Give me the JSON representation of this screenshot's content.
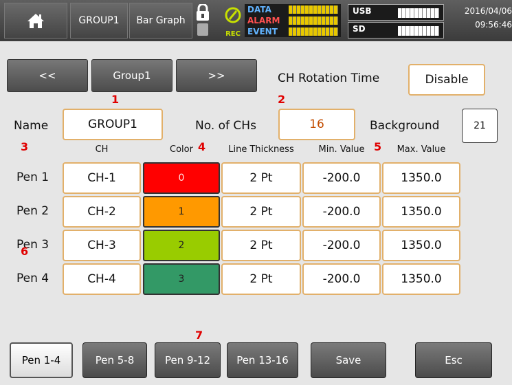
{
  "topbar": {
    "group": "GROUP1",
    "view": "Bar Graph",
    "rec": "REC",
    "status": [
      {
        "label": "DATA",
        "color": "#62b4ff"
      },
      {
        "label": "ALARM",
        "color": "#ff5050"
      },
      {
        "label": "EVENT",
        "color": "#62b4ff"
      }
    ],
    "media": [
      {
        "label": "USB",
        "icon": "usb-icon"
      },
      {
        "label": "SD",
        "icon": "sd-card-icon"
      }
    ],
    "date": "2016/04/06",
    "time": "09:56:46"
  },
  "nav": {
    "prev": "<<",
    "group": "Group1",
    "next": ">>"
  },
  "rotation": {
    "label": "CH Rotation Time",
    "value": "Disable"
  },
  "name": {
    "label": "Name",
    "value": "GROUP1"
  },
  "channels": {
    "label": "No. of CHs",
    "value": "16"
  },
  "background": {
    "label": "Background",
    "value": "21"
  },
  "columns": {
    "ch": "CH",
    "color": "Color",
    "thickness": "Line Thickness",
    "min": "Min. Value",
    "max": "Max. Value"
  },
  "pens": [
    {
      "label": "Pen 1",
      "ch": "CH-1",
      "color_index": "0",
      "color": "#ff0000",
      "thickness": "2 Pt",
      "min": "-200.0",
      "max": "1350.0"
    },
    {
      "label": "Pen 2",
      "ch": "CH-2",
      "color_index": "1",
      "color": "#ff9900",
      "thickness": "2 Pt",
      "min": "-200.0",
      "max": "1350.0"
    },
    {
      "label": "Pen 3",
      "ch": "CH-3",
      "color_index": "2",
      "color": "#99cc00",
      "thickness": "2 Pt",
      "min": "-200.0",
      "max": "1350.0"
    },
    {
      "label": "Pen 4",
      "ch": "CH-4",
      "color_index": "3",
      "color": "#339966",
      "thickness": "2 Pt",
      "min": "-200.0",
      "max": "1350.0"
    }
  ],
  "markers": [
    "1",
    "2",
    "3",
    "4",
    "5",
    "6",
    "7"
  ],
  "pages": [
    "Pen 1-4",
    "Pen 5-8",
    "Pen 9-12",
    "Pen 13-16"
  ],
  "actions": {
    "save": "Save",
    "esc": "Esc"
  }
}
